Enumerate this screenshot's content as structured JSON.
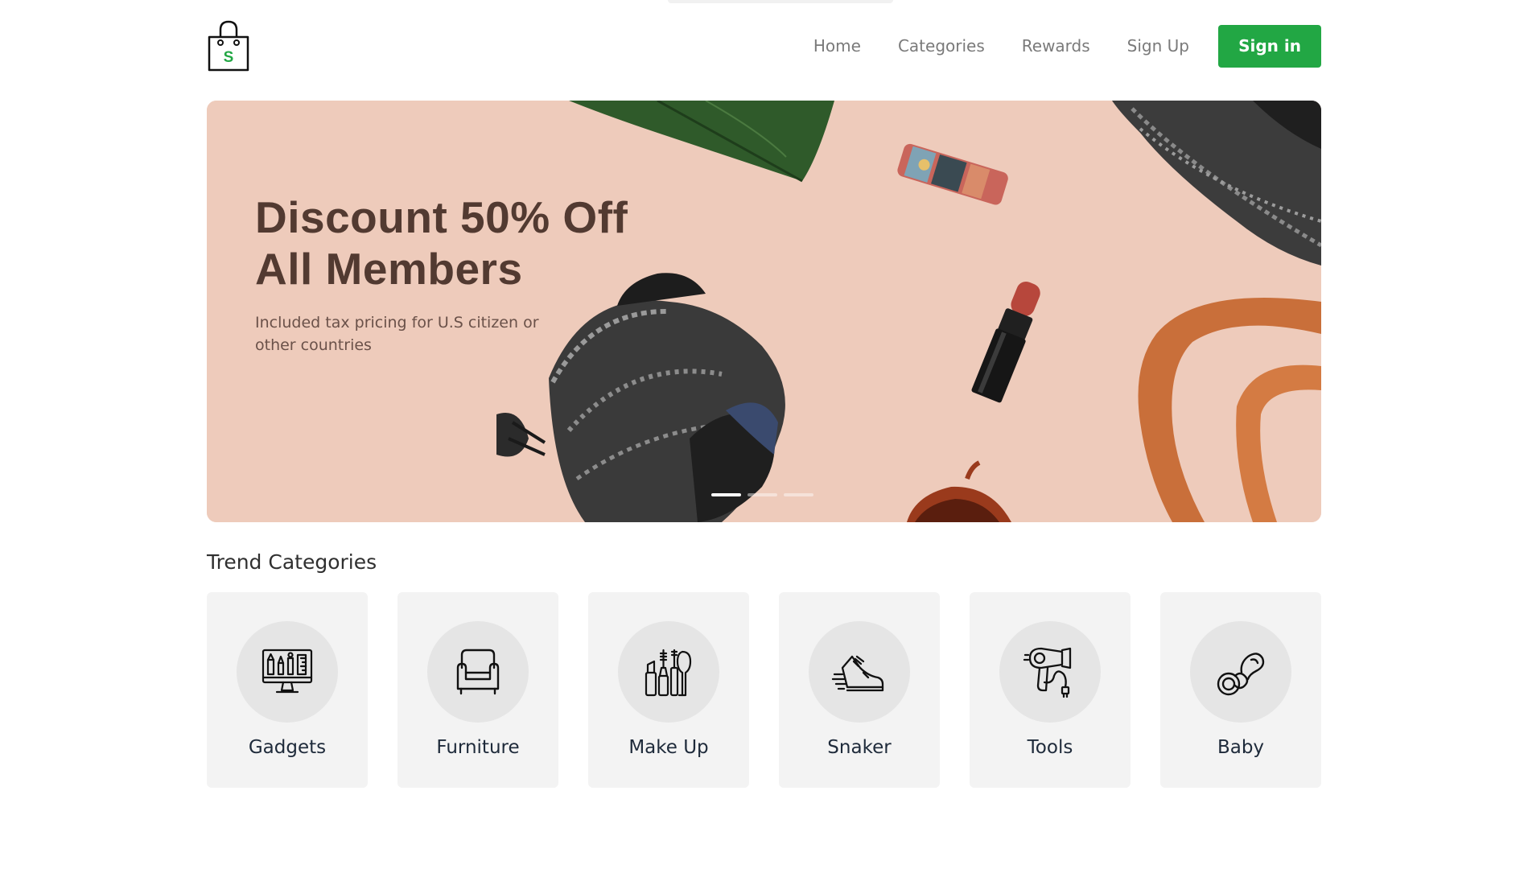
{
  "nav": {
    "logo_icon": "shopping-bag-dollar-icon",
    "links": [
      "Home",
      "Categories",
      "Rewards",
      "Sign Up"
    ],
    "signin_label": "Sign in",
    "accent_color": "#22a744"
  },
  "hero": {
    "title_line1": "Discount 50% Off",
    "title_line2": "All Members",
    "subtitle": "Included tax pricing for U.S citizen or other countries",
    "slides_total": 3,
    "active_slide": 1
  },
  "categories": {
    "title": "Trend Categories",
    "items": [
      {
        "label": "Gadgets",
        "icon": "monitor-tools-icon"
      },
      {
        "label": "Furniture",
        "icon": "armchair-icon"
      },
      {
        "label": "Make Up",
        "icon": "makeup-icon"
      },
      {
        "label": "Snaker",
        "icon": "sneaker-icon"
      },
      {
        "label": "Tools",
        "icon": "hair-dryer-icon"
      },
      {
        "label": "Baby",
        "icon": "pacifier-icon"
      }
    ]
  }
}
